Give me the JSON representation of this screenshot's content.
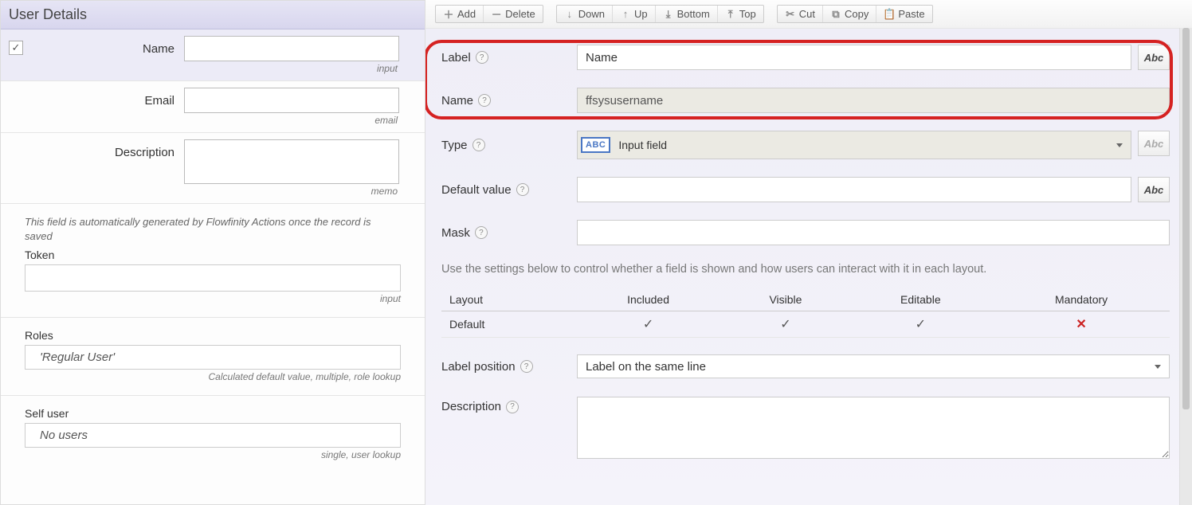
{
  "left": {
    "title": "User Details",
    "fields": {
      "name": {
        "label": "Name",
        "hint": "input"
      },
      "email": {
        "label": "Email",
        "hint": "email"
      },
      "description": {
        "label": "Description",
        "hint": "memo"
      }
    },
    "token": {
      "note": "This field is automatically generated by Flowfinity Actions once the record is saved",
      "label": "Token",
      "hint": "input"
    },
    "roles": {
      "label": "Roles",
      "value": "'Regular User'",
      "hint": "Calculated default value, multiple, role lookup"
    },
    "selfuser": {
      "label": "Self user",
      "value": "No users",
      "hint": "single, user lookup"
    }
  },
  "toolbar": {
    "add": "Add",
    "delete": "Delete",
    "down": "Down",
    "up": "Up",
    "bottom": "Bottom",
    "top": "Top",
    "cut": "Cut",
    "copy": "Copy",
    "paste": "Paste"
  },
  "form": {
    "label": {
      "lbl": "Label",
      "value": "Name"
    },
    "name": {
      "lbl": "Name",
      "value": "ffsysusername"
    },
    "type": {
      "lbl": "Type",
      "value": "Input field"
    },
    "defaultValue": {
      "lbl": "Default value"
    },
    "mask": {
      "lbl": "Mask"
    },
    "layoutHint": "Use the settings below to control whether a field is shown and how users can interact with it in each layout.",
    "layoutTable": {
      "headers": [
        "Layout",
        "Included",
        "Visible",
        "Editable",
        "Mandatory"
      ],
      "row": {
        "name": "Default",
        "included": true,
        "visible": true,
        "editable": true,
        "mandatory": false
      }
    },
    "labelPosition": {
      "lbl": "Label position",
      "value": "Label on the same line"
    },
    "description": {
      "lbl": "Description"
    },
    "abc": "Abc",
    "abcChip": "ABC"
  }
}
